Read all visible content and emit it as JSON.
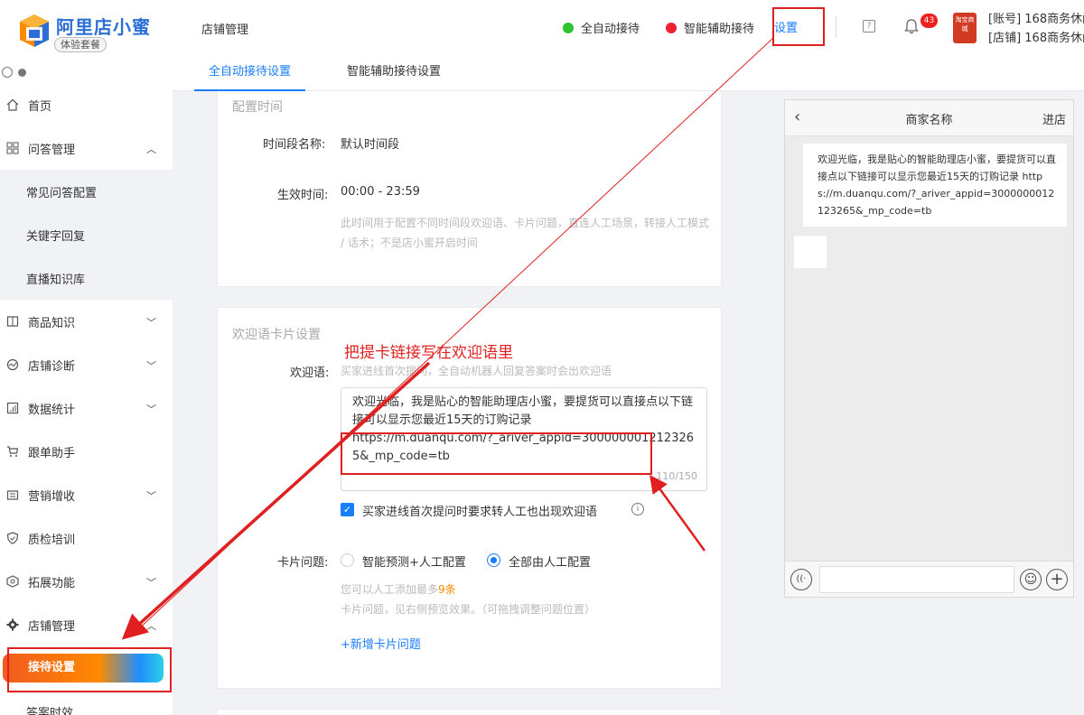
{
  "app": {
    "name": "阿里店小蜜",
    "plan": "体验套餐"
  },
  "sidebar": {
    "items": [
      {
        "label": "首页",
        "icon": "home-icon"
      },
      {
        "label": "问答管理",
        "icon": "qa-icon",
        "expanded": true
      },
      {
        "label": "常见问答配置",
        "sub": true
      },
      {
        "label": "关键字回复",
        "sub": true
      },
      {
        "label": "直播知识库",
        "sub": true
      },
      {
        "label": "商品知识",
        "icon": "goods-icon"
      },
      {
        "label": "店铺诊断",
        "icon": "diagnosis-icon"
      },
      {
        "label": "数据统计",
        "icon": "stats-icon"
      },
      {
        "label": "跟单助手",
        "icon": "cart-icon"
      },
      {
        "label": "营销增收",
        "icon": "marketing-icon"
      },
      {
        "label": "质检培训",
        "icon": "shield-icon"
      },
      {
        "label": "拓展功能",
        "icon": "extension-icon"
      },
      {
        "label": "店铺管理",
        "icon": "gear-icon",
        "expanded": true
      },
      {
        "label": "接待设置",
        "active": true
      },
      {
        "label": "答案时效",
        "sub": true
      }
    ]
  },
  "header": {
    "title": "店铺管理",
    "status_auto": "全自动接待",
    "status_smart": "智能辅助接待",
    "settings": "设置",
    "notification_count": "43",
    "account_line1": "[账号] 168商务休闲",
    "account_line2": "[店铺] 168商务休闲",
    "avatar_text": "淘宝商城",
    "colors": {
      "accent": "#1a7cff",
      "green": "#2ec42e",
      "red": "#f02030"
    }
  },
  "tabs": [
    {
      "label": "全自动接待设置",
      "active": true
    },
    {
      "label": "智能辅助接待设置",
      "active": false
    }
  ],
  "time_config": {
    "section_title": "配置时间",
    "period_name_label": "时间段名称:",
    "period_name_value": "默认时间段",
    "effective_label": "生效时间:",
    "effective_value": "00:00 - 23:59",
    "hint": "此时间用于配置不同时间段欢迎语、卡片问题，直连人工场景，转接人工模式 / 话术；不是店小蜜开启时间"
  },
  "welcome_card": {
    "section_title": "欢迎语卡片设置",
    "greeting_label": "欢迎语:",
    "greeting_hint": "买家进线首次提问，全自动机器人回复答案时会出欢迎语",
    "greeting_text": "欢迎光临，我是贴心的智能助理店小蜜，要提货可以直接点以下链接可以显示您最近15天的订购记录",
    "greeting_link": "https://m.duanqu.com/?_ariver_appid=3000000012123265&_mp_code=tb",
    "char_count": "110/150",
    "checkbox_label": "买家进线首次提问时要求转人工也出现欢迎语",
    "card_question_label": "卡片问题:",
    "radio_smart": "智能预测+人工配置",
    "radio_manual": "全部由人工配置",
    "card_hint_pre": "您可以人工添加最多",
    "card_hint_num": "9条",
    "card_hint_post": "卡片问题，见右侧预览效果。（可拖拽调整问题位置）",
    "add_link": "+新增卡片问题"
  },
  "preview": {
    "title": "商家名称",
    "enter_shop": "进店",
    "message": "欢迎光临，我是贴心的智能助理店小蜜，要提货可以直接点以下链接可以显示您最近15天的订购记录 https://m.duanqu.com/?_ariver_appid=3000000012123265&_mp_code=tb"
  },
  "annotation": {
    "text": "把提卡链接写在欢迎语里"
  }
}
